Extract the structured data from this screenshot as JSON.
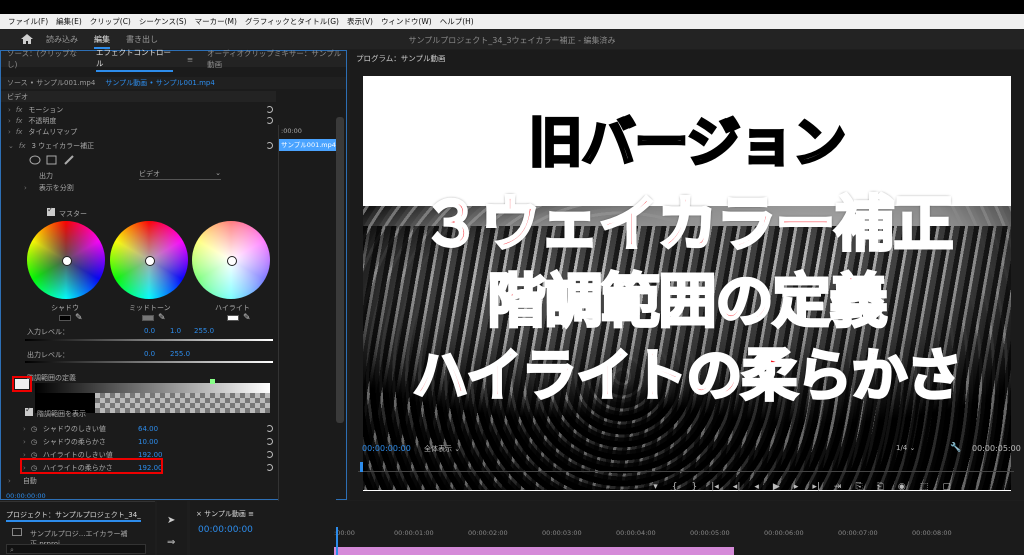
{
  "menu": [
    "ファイル(F)",
    "編集(E)",
    "クリップ(C)",
    "シーケンス(S)",
    "マーカー(M)",
    "グラフィックとタイトル(G)",
    "表示(V)",
    "ウィンドウ(W)",
    "ヘルプ(H)"
  ],
  "workspace": {
    "tabs": [
      "読み込み",
      "編集",
      "書き出し"
    ],
    "active": "編集",
    "project_title": "サンプルプロジェクト_34_3ウェイカラー補正 - 編集済み"
  },
  "left_panel": {
    "tabs": [
      "ソース：(クリップなし)",
      "エフェクトコントロール",
      "≡",
      "オーディオクリップミキサー：サンプル動画"
    ],
    "source": "ソース • サンプル001.mp4",
    "sequence": "サンプル動画 • サンプル001.mp4",
    "video_label": "ビデオ",
    "effects": [
      "モーション",
      "不透明度",
      "タイムリマップ",
      "3 ウェイカラー補正"
    ],
    "output_label": "出力",
    "output_value": "ビデオ",
    "split_label": "表示を分割",
    "master_label": "マスター",
    "wheels": [
      "シャドウ",
      "ミッドトーン",
      "ハイライト"
    ],
    "input_levels": {
      "label": "入力レベル：",
      "v1": "0.0",
      "v2": "1.0",
      "v3": "255.0"
    },
    "output_levels": {
      "label": "出力レベル：",
      "v1": "0.0",
      "v2": "255.0"
    },
    "tonal_label": "階調範囲の定義",
    "show_tonal": "階調範囲を表示",
    "params": [
      {
        "name": "シャドウのしきい値",
        "value": "64.00"
      },
      {
        "name": "シャドウの柔らかさ",
        "value": "10.00"
      },
      {
        "name": "ハイライトのしきい値",
        "value": "192.00"
      },
      {
        "name": "ハイライトの柔らかさ",
        "value": "192.00"
      }
    ],
    "auto_label": "自動",
    "timecode": "00:00:00:00",
    "mini_time": ":00:00",
    "mini_clip": "サンプル001.mp4"
  },
  "program": {
    "title": "プログラム：サンプル動画",
    "time": "00:00:00:00",
    "fit": "全体表示",
    "fraction": "1/4",
    "duration": "00:00:05:00",
    "overlay": [
      "旧バージョン",
      "３ウェイカラー補正",
      "階調範囲の定義",
      "ハイライトの柔らかさ"
    ],
    "transport": [
      "▾",
      "{",
      "}",
      "|◂",
      "◂|",
      "◂",
      "▶",
      "▸",
      "▸|",
      "⇥",
      "⎘",
      "⎗",
      "◉",
      "⬚",
      "▢"
    ]
  },
  "project_panel": {
    "tab": "プロジェクト：サンプルプロジェクト_34_",
    "file": "サンプルプロジ...エイカラー補正.prproj"
  },
  "timeline": {
    "tab": "サンプル動画",
    "time": "00:00:00:00",
    "ruler": [
      ":00:00",
      "00:00:01:00",
      "00:00:02:00",
      "00:00:03:00",
      "00:00:04:00",
      "00:00:05:00",
      "00:00:06:00",
      "00:00:07:00",
      "00:00:08:00"
    ]
  },
  "colors": {
    "accent": "#2d8ceb",
    "title_red": "#f5141e",
    "highlight_box": "#e00000"
  }
}
